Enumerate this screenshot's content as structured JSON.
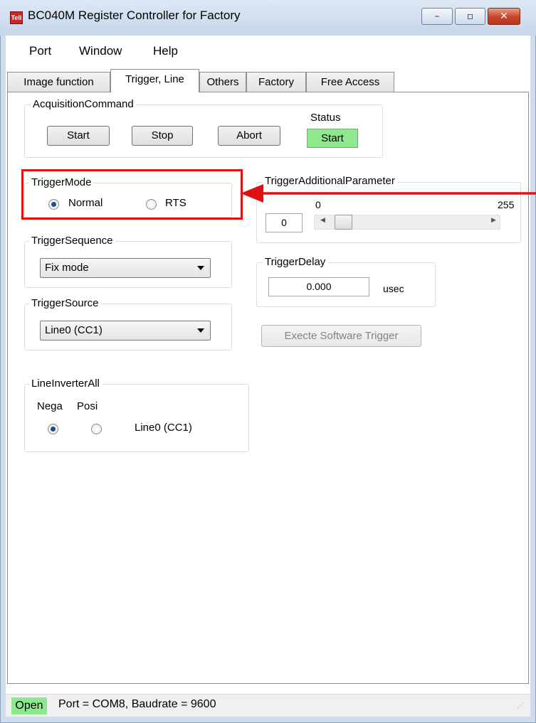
{
  "window": {
    "title": "BC040M Register Controller for Factory",
    "app_icon_text": "Teli",
    "min_glyph": "–",
    "max_glyph": "▫",
    "close_glyph": "✕"
  },
  "menu": [
    "Port",
    "Window",
    "Help"
  ],
  "tabs": [
    "Image function",
    "Trigger, Line",
    "Others",
    "Factory",
    "Free Access"
  ],
  "acquisition": {
    "label": "AcquisitionCommand",
    "start": "Start",
    "stop": "Stop",
    "abort": "Abort",
    "status_label": "Status",
    "status_value": "Start"
  },
  "trigger_mode": {
    "label": "TriggerMode",
    "options": [
      "Normal",
      "RTS"
    ],
    "selected": "Normal"
  },
  "trigger_additional": {
    "label": "TriggerAdditionalParameter",
    "value": "0",
    "min": "0",
    "max": "255",
    "scroll_left": "◀",
    "scroll_right": "▶"
  },
  "trigger_sequence": {
    "label": "TriggerSequence",
    "selected": "Fix mode"
  },
  "trigger_delay": {
    "label": "TriggerDelay",
    "value": "0.000",
    "unit": "usec"
  },
  "trigger_source": {
    "label": "TriggerSource",
    "selected": "Line0 (CC1)"
  },
  "software_trigger": {
    "label": "Execte Software Trigger"
  },
  "line_inverter": {
    "label": "LineInverterAll",
    "nega": "Nega",
    "posi": "Posi",
    "line_label": "Line0 (CC1)",
    "selected": "Nega"
  },
  "status_bar": {
    "state": "Open",
    "info": "Port = COM8,  Baudrate = 9600"
  },
  "colors": {
    "highlight": "#e01010",
    "status_green": "#8ee88e"
  }
}
